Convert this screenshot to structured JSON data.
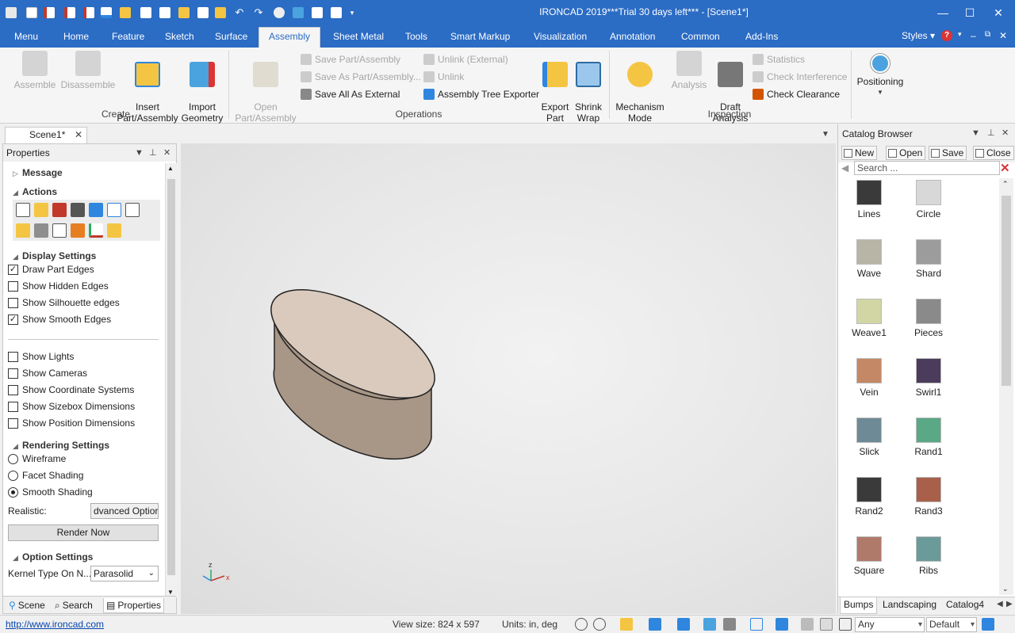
{
  "window": {
    "title": "IRONCAD 2019***Trial 30 days left*** - [Scene1*]",
    "min_glyph": "—",
    "max_glyph": "☐",
    "close_glyph": "✕"
  },
  "ribbon_tabs": [
    "Menu",
    "Home",
    "Feature",
    "Sketch",
    "Surface",
    "Assembly",
    "Sheet Metal",
    "Tools",
    "Smart Markup",
    "Visualization",
    "Annotation",
    "Common",
    "Add-Ins"
  ],
  "active_tab": "Assembly",
  "styles_label": "Styles",
  "ribbon": {
    "create": {
      "label": "Create",
      "assemble": "Assemble",
      "disassemble": "Disassemble",
      "insert": "Insert\nPart/Assembly",
      "import": "Import\nGeometry"
    },
    "operations": {
      "label": "Operations",
      "open": "Open\nPart/Assembly",
      "save_part": "Save Part/Assembly",
      "save_as_part": "Save As Part/Assembly...",
      "save_all_external": "Save All As External",
      "unlink_external": "Unlink (External)",
      "unlink": "Unlink",
      "tree_exporter": "Assembly Tree Exporter",
      "export_part": "Export\nPart",
      "shrink_wrap": "Shrink\nWrap"
    },
    "inspection": {
      "label": "Inspection",
      "mechanism": "Mechanism\nMode",
      "analysis": "Analysis",
      "draft": "Draft\nAnalysis",
      "statistics": "Statistics",
      "check_interference": "Check Interference",
      "check_clearance": "Check Clearance"
    },
    "positioning": "Positioning"
  },
  "document_tab": "Scene1*",
  "properties": {
    "header": "Properties",
    "message": "Message",
    "actions": "Actions",
    "display_settings": "Display Settings",
    "display_checks": [
      {
        "label": "Draw Part Edges",
        "checked": true
      },
      {
        "label": "Show Hidden Edges",
        "checked": false
      },
      {
        "label": "Show Silhouette edges",
        "checked": false
      },
      {
        "label": "Show Smooth Edges",
        "checked": true
      }
    ],
    "show_checks": [
      {
        "label": "Show Lights",
        "checked": false
      },
      {
        "label": "Show Cameras",
        "checked": false
      },
      {
        "label": "Show Coordinate Systems",
        "checked": false
      },
      {
        "label": "Show Sizebox Dimensions",
        "checked": false
      },
      {
        "label": "Show Position Dimensions",
        "checked": false
      }
    ],
    "rendering_settings": "Rendering Settings",
    "render_options": [
      {
        "label": "Wireframe",
        "selected": false
      },
      {
        "label": "Facet Shading",
        "selected": false
      },
      {
        "label": "Smooth Shading",
        "selected": true
      }
    ],
    "realistic_label": "Realistic:",
    "realistic_value": "dvanced Optior",
    "render_now": "Render Now",
    "option_settings": "Option Settings",
    "kernel_label": "Kernel Type On N...",
    "kernel_value": "Parasolid",
    "bottom_tabs": [
      "Scene",
      "Search",
      "Properties"
    ]
  },
  "catalog": {
    "header": "Catalog Browser",
    "new": "New",
    "open": "Open",
    "save": "Save",
    "close": "Close",
    "search_placeholder": "Search ...",
    "items": [
      {
        "name": "Lines",
        "color": "#3a3a3a"
      },
      {
        "name": "Circle",
        "color": "#d8d8d8"
      },
      {
        "name": "Wave",
        "color": "#b8b4a6"
      },
      {
        "name": "Shard",
        "color": "#9c9c9c"
      },
      {
        "name": "Weave1",
        "color": "#d2d6a4"
      },
      {
        "name": "Pieces",
        "color": "#8a8a8a"
      },
      {
        "name": "Vein",
        "color": "#c48866"
      },
      {
        "name": "Swirl1",
        "color": "#4a3c5a"
      },
      {
        "name": "Slick",
        "color": "#6e8a96"
      },
      {
        "name": "Rand1",
        "color": "#5aa886"
      },
      {
        "name": "Rand2",
        "color": "#3a3a3a"
      },
      {
        "name": "Rand3",
        "color": "#a8604a"
      },
      {
        "name": "Square",
        "color": "#b07a6a"
      },
      {
        "name": "Ribs",
        "color": "#6a9a9a"
      }
    ],
    "bottom_tabs": [
      "Bumps",
      "Landscaping",
      "Catalog4"
    ]
  },
  "status": {
    "link": "http://www.ironcad.com",
    "view_size": "View size:  824 x  597",
    "units": "Units: in, deg",
    "filter": "Any",
    "style": "Default"
  },
  "colors": {
    "accent": "#2b6cc4",
    "part_top": "#d9cabd",
    "part_side": "#a89686"
  }
}
